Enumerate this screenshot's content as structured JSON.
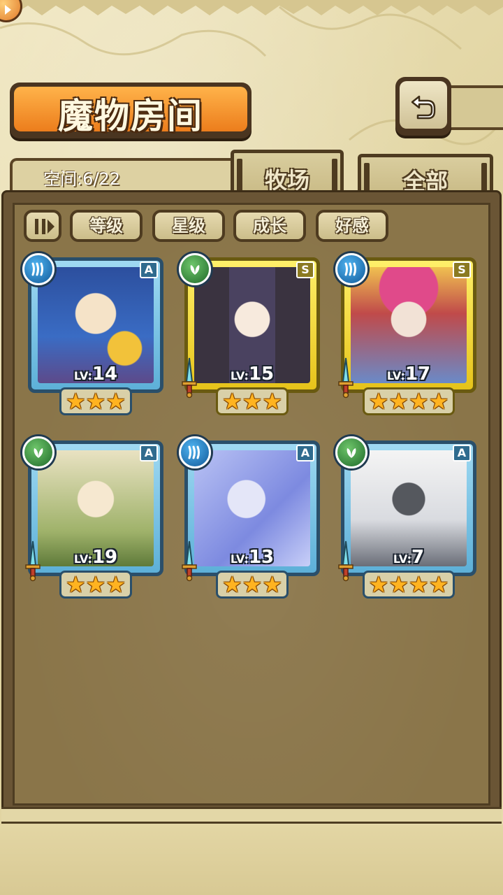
{
  "screen": {
    "title": "魔物房间",
    "space_label": "空间:6/22"
  },
  "tabs": [
    {
      "label": "牧场",
      "active": true
    },
    {
      "label": "全部",
      "active": false
    }
  ],
  "filters": {
    "sort_icon": "sort-toggle-icon",
    "buttons": [
      "等级",
      "星级",
      "成长",
      "好感"
    ]
  },
  "monsters": [
    {
      "level_prefix": "LV:",
      "level": "14",
      "rank": "A",
      "element": "water",
      "stars": 3,
      "frame": "blue",
      "sword": false
    },
    {
      "level_prefix": "LV:",
      "level": "15",
      "rank": "S",
      "element": "leaf",
      "stars": 3,
      "frame": "yellow",
      "sword": true
    },
    {
      "level_prefix": "LV:",
      "level": "17",
      "rank": "S",
      "element": "water",
      "stars": 4,
      "frame": "yellow",
      "sword": true
    },
    {
      "level_prefix": "LV:",
      "level": "19",
      "rank": "A",
      "element": "leaf",
      "stars": 3,
      "frame": "blue",
      "sword": true
    },
    {
      "level_prefix": "LV:",
      "level": "13",
      "rank": "A",
      "element": "water",
      "stars": 3,
      "frame": "blue",
      "sword": true
    },
    {
      "level_prefix": "LV:",
      "level": "7",
      "rank": "A",
      "element": "leaf",
      "stars": 4,
      "frame": "blue",
      "sword": true
    }
  ],
  "colors": {
    "accent_orange": "#ec7d1c",
    "frame_blue": "#5db0d8",
    "frame_yellow": "#e6c31a",
    "star": "#ffb320"
  }
}
